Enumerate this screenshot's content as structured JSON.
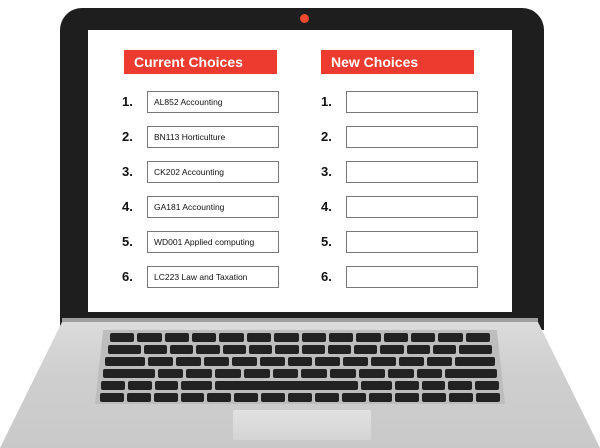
{
  "current": {
    "header": "Current Choices",
    "rows": [
      {
        "num": "1.",
        "value": "AL852 Accounting"
      },
      {
        "num": "2.",
        "value": "BN113 Horticulture"
      },
      {
        "num": "3.",
        "value": "CK202 Accounting"
      },
      {
        "num": "4.",
        "value": "GA181 Accounting"
      },
      {
        "num": "5.",
        "value": "WD001 Applied computing"
      },
      {
        "num": "6.",
        "value": "LC223 Law and Taxation"
      }
    ]
  },
  "new": {
    "header": "New Choices",
    "rows": [
      {
        "num": "1.",
        "value": ""
      },
      {
        "num": "2.",
        "value": ""
      },
      {
        "num": "3.",
        "value": ""
      },
      {
        "num": "4.",
        "value": ""
      },
      {
        "num": "5.",
        "value": ""
      },
      {
        "num": "6.",
        "value": ""
      }
    ]
  },
  "colors": {
    "accent": "#ee3b2f",
    "bezel": "#1e1e1e",
    "camera": "#f0492f"
  }
}
